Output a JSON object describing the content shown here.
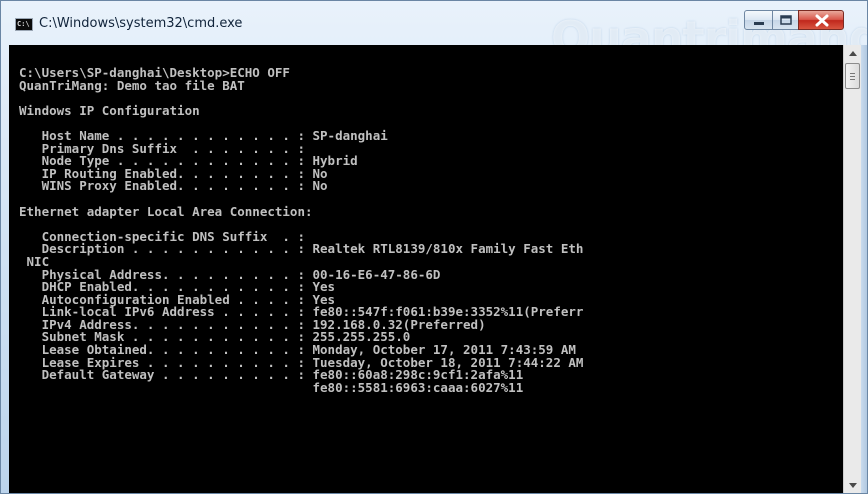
{
  "window": {
    "title": "C:\\Windows\\system32\\cmd.exe",
    "icon_label": "C:\\",
    "watermark": "Quantrimang"
  },
  "console": {
    "lines": [
      "C:\\Users\\SP-danghai\\Desktop>ECHO OFF",
      "QuanTriMang: Demo tao file BAT",
      "",
      "Windows IP Configuration",
      "",
      "   Host Name . . . . . . . . . . . . : SP-danghai",
      "   Primary Dns Suffix  . . . . . . . :",
      "   Node Type . . . . . . . . . . . . : Hybrid",
      "   IP Routing Enabled. . . . . . . . : No",
      "   WINS Proxy Enabled. . . . . . . . : No",
      "",
      "Ethernet adapter Local Area Connection:",
      "",
      "   Connection-specific DNS Suffix  . :",
      "   Description . . . . . . . . . . . : Realtek RTL8139/810x Family Fast Eth",
      " NIC",
      "   Physical Address. . . . . . . . . : 00-16-E6-47-86-6D",
      "   DHCP Enabled. . . . . . . . . . . : Yes",
      "   Autoconfiguration Enabled . . . . : Yes",
      "   Link-local IPv6 Address . . . . . : fe80::547f:f061:b39e:3352%11(Preferr",
      "   IPv4 Address. . . . . . . . . . . : 192.168.0.32(Preferred)",
      "   Subnet Mask . . . . . . . . . . . : 255.255.255.0",
      "   Lease Obtained. . . . . . . . . . : Monday, October 17, 2011 7:43:59 AM",
      "   Lease Expires . . . . . . . . . . : Tuesday, October 18, 2011 7:44:22 AM",
      "   Default Gateway . . . . . . . . . : fe80::60a8:298c:9cf1:2afa%11",
      "                                       fe80::5581:6963:caaa:6027%11"
    ]
  },
  "colors": {
    "console_bg": "#000000",
    "console_text": "#c0c0c0",
    "close_button": "#c0271c"
  }
}
